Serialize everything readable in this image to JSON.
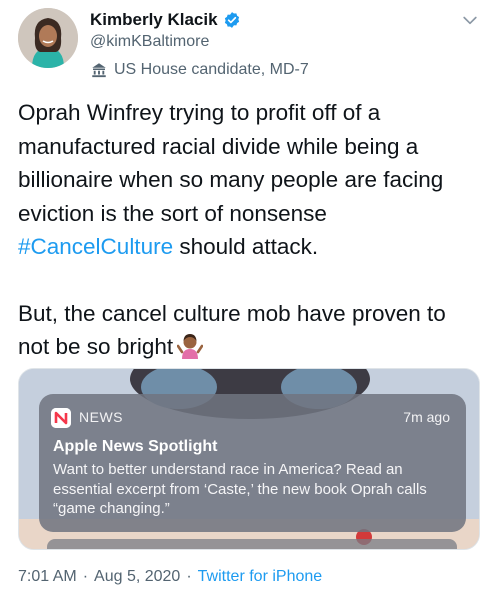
{
  "author": {
    "display_name": "Kimberly Klacik",
    "handle": "@kimKBaltimore",
    "label": "US House candidate, MD-7"
  },
  "tweet": {
    "line_part1": "Oprah Winfrey trying to profit off of a manufactured racial divide while being a billionaire when so many people are facing eviction is the sort of nonsense ",
    "hashtag": "#CancelCulture",
    "line_part2": " should attack.",
    "paragraph2": "But, the cancel culture mob have proven to not be so bright"
  },
  "notification": {
    "app_name": "NEWS",
    "time": "7m ago",
    "title": "Apple News Spotlight",
    "body": "Want to better understand race in America? Read an essential excerpt from ‘Caste,’ the new book Oprah calls “game changing.”"
  },
  "meta": {
    "time": "7:01 AM",
    "date": "Aug 5, 2020",
    "separator": "·",
    "source": "Twitter for iPhone"
  },
  "colors": {
    "accent": "#1d9bf0",
    "secondary_text": "#536471",
    "verified": "#1d9bf0"
  },
  "icons": {
    "verified": "verified-badge-icon",
    "label": "government-building-icon",
    "chevron": "chevron-down-icon",
    "emoji": "person-shrugging-emoji",
    "app": "apple-news-icon"
  }
}
